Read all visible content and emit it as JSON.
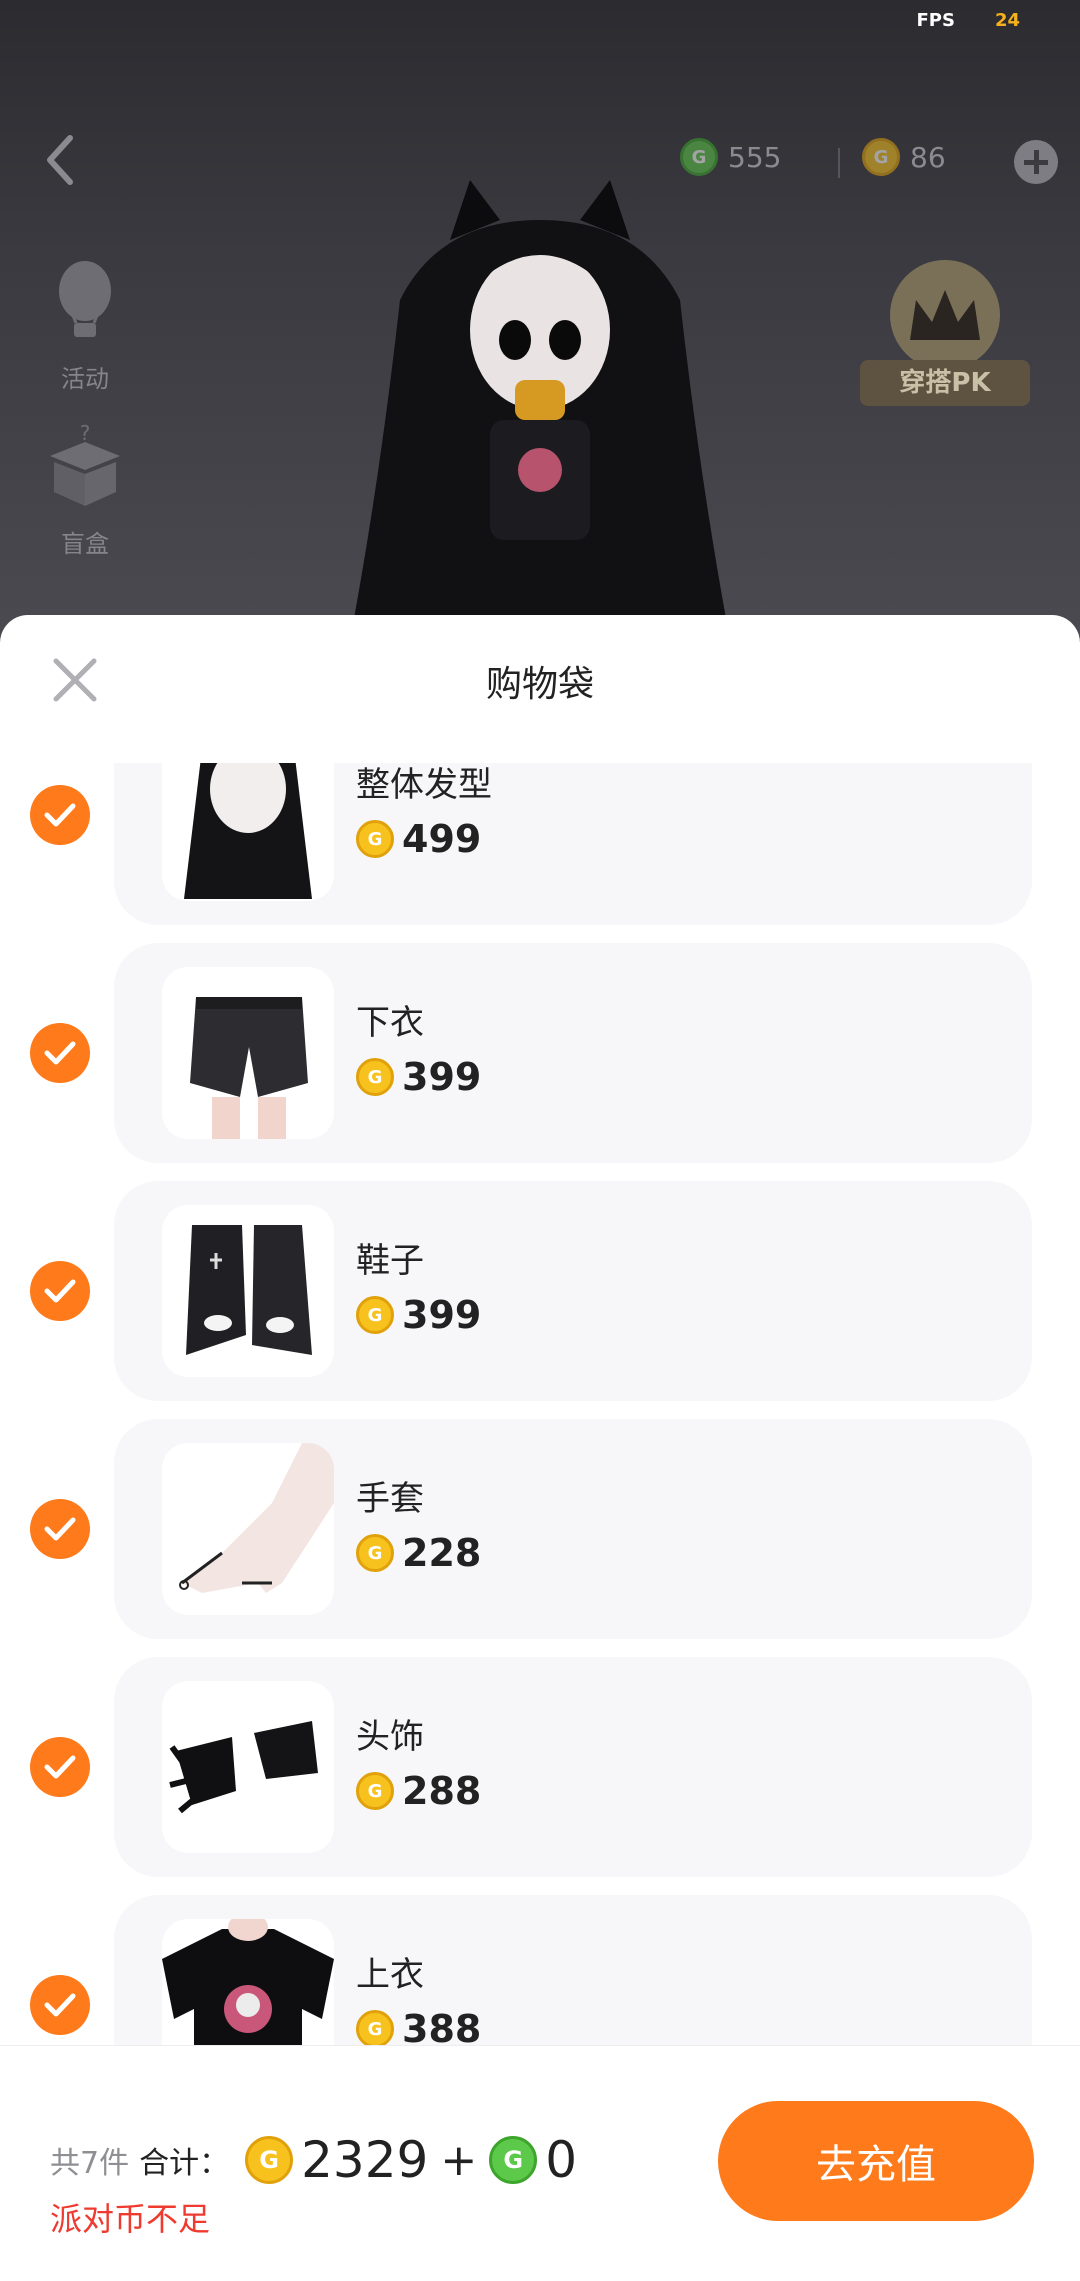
{
  "status": {
    "fps_label": "FPS",
    "fps_value": "24"
  },
  "topbar": {
    "green_coin_balance": "555",
    "gold_coin_balance": "86"
  },
  "side_menu": [
    {
      "label": "活动",
      "icon": "hot-air-balloon-icon"
    },
    {
      "label": "盲盒",
      "icon": "mystery-box-icon"
    }
  ],
  "pk_badge": {
    "label": "穿搭PK"
  },
  "sheet": {
    "title": "购物袋"
  },
  "items": [
    {
      "name": "整体发型",
      "price": "499",
      "checked": true,
      "thumb": "hairstyle"
    },
    {
      "name": "下衣",
      "price": "399",
      "checked": true,
      "thumb": "shorts"
    },
    {
      "name": "鞋子",
      "price": "399",
      "checked": true,
      "thumb": "boots"
    },
    {
      "name": "手套",
      "price": "228",
      "checked": true,
      "thumb": "gloves"
    },
    {
      "name": "头饰",
      "price": "288",
      "checked": true,
      "thumb": "cat-ears"
    },
    {
      "name": "上衣",
      "price": "388",
      "checked": true,
      "thumb": "top"
    }
  ],
  "footer": {
    "count_text": "共7件",
    "total_label": "合计：",
    "gold_total": "2329",
    "plus": "+",
    "green_total": "0",
    "warning": "派对币不足",
    "recharge_label": "去充值"
  },
  "colors": {
    "accent": "#ff7a1a",
    "warning": "#ee3a2f",
    "gold_coin": "#f7c21d",
    "green_coin": "#5cc94a"
  }
}
